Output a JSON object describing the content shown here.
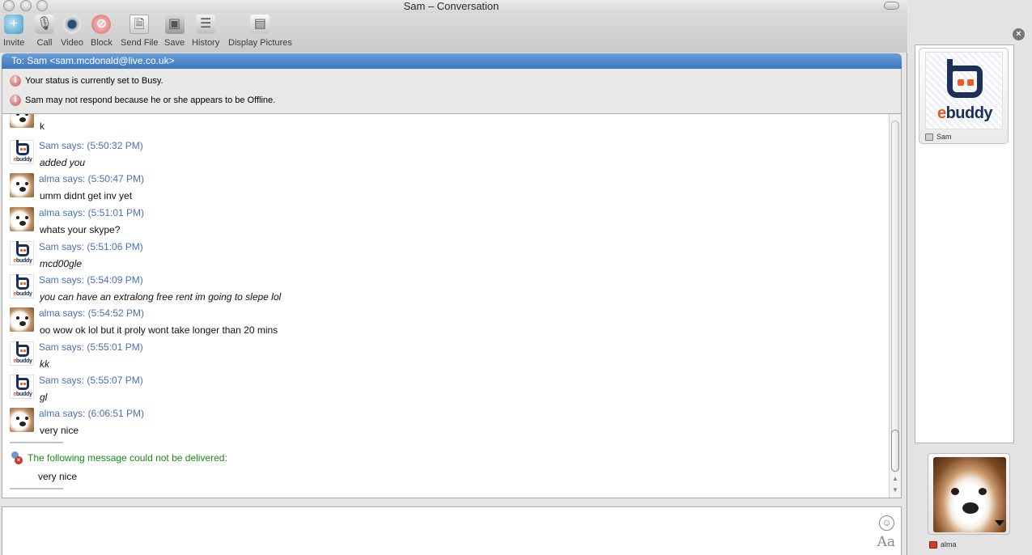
{
  "window": {
    "title": "Sam – Conversation"
  },
  "toolbar": {
    "items": [
      {
        "label": "Invite",
        "icon": "invite-icon"
      },
      {
        "label": "Call",
        "icon": "microphone-icon"
      },
      {
        "label": "Video",
        "icon": "webcam-icon"
      },
      {
        "label": "Block",
        "icon": "block-icon"
      },
      {
        "label": "Send File",
        "icon": "send-file-icon"
      },
      {
        "label": "Save",
        "icon": "floppy-disk-icon"
      },
      {
        "label": "History",
        "icon": "history-icon"
      },
      {
        "label": "Display Pictures",
        "icon": "display-pictures-icon"
      }
    ]
  },
  "header": {
    "to": "To: Sam <sam.mcdonald@live.co.uk>",
    "status_busy": "Your status is currently set to Busy.",
    "status_offline": "Sam may not respond because he or she appears to be Offline."
  },
  "messages": [
    {
      "sender": "alma",
      "header": "",
      "text": "k",
      "italic": false
    },
    {
      "sender": "sam",
      "header": "Sam says: (5:50:32 PM)",
      "text": "added you",
      "italic": true
    },
    {
      "sender": "alma",
      "header": "alma says: (5:50:47 PM)",
      "text": "umm didnt get inv yet",
      "italic": false
    },
    {
      "sender": "alma",
      "header": "alma says: (5:51:01 PM)",
      "text": "whats your skype?",
      "italic": false
    },
    {
      "sender": "sam",
      "header": "Sam says: (5:51:06 PM)",
      "text": "mcd00gle",
      "italic": true
    },
    {
      "sender": "sam",
      "header": "Sam says: (5:54:09 PM)",
      "text": "you can have an extralong free rent im going to slepe lol",
      "italic": true
    },
    {
      "sender": "alma",
      "header": "alma says: (5:54:52 PM)",
      "text": "oo wow ok lol but it proly wont take longer than 20 mins",
      "italic": false
    },
    {
      "sender": "sam",
      "header": "Sam says: (5:55:01 PM)",
      "text": "kk",
      "italic": true
    },
    {
      "sender": "sam",
      "header": "Sam says: (5:55:07 PM)",
      "text": "gl",
      "italic": true
    },
    {
      "sender": "alma",
      "header": "alma says: (6:06:51 PM)",
      "text": "very nice",
      "italic": false
    }
  ],
  "delivery_failure": {
    "notice": "The following message could not be delivered:",
    "text": "very nice"
  },
  "avatar_logo": {
    "word_prefix": "e",
    "word_rest": "buddy"
  },
  "sidebar": {
    "contact_name": "Sam",
    "me_name": "alma"
  },
  "input": {
    "value": "",
    "placeholder": ""
  },
  "colors": {
    "accent": "#4a6fba",
    "header_bar": "#3e76bf",
    "failure": "#178a17",
    "brand_orange": "#f05a22",
    "brand_navy": "#1c2f57"
  }
}
